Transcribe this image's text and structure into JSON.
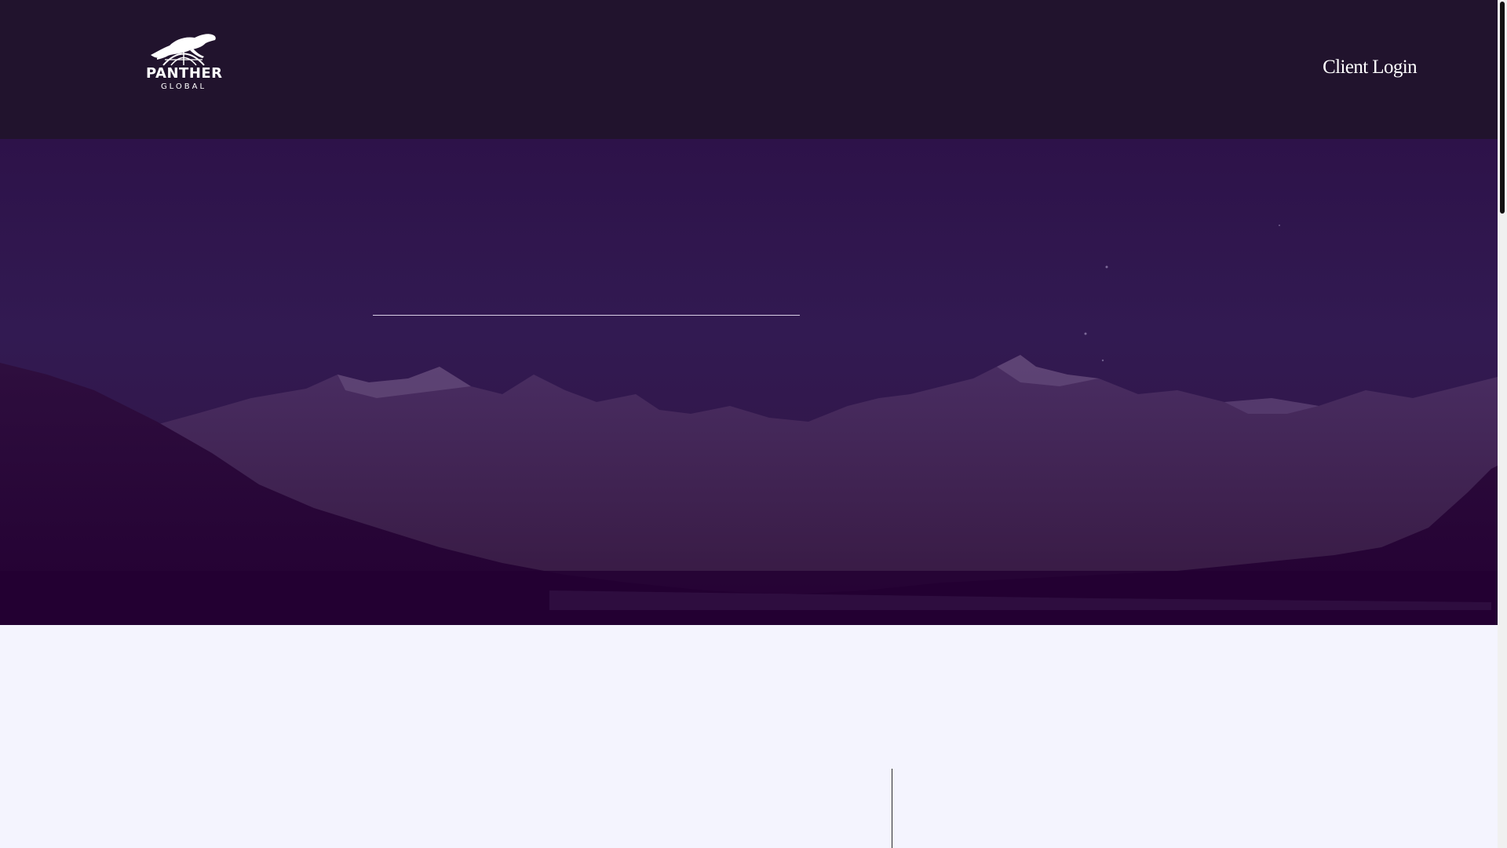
{
  "header": {
    "logo": {
      "icon": "panther-globe-icon",
      "line1": "PANTHER",
      "line2": "GLOBAL"
    },
    "client_login_label": "Client Login"
  },
  "colors": {
    "header_bg": "#21132d",
    "hero_top": "#2d1249",
    "hero_bottom": "#2a0a38",
    "content_bg": "#f4f4fe",
    "text_light": "#ffffff"
  }
}
